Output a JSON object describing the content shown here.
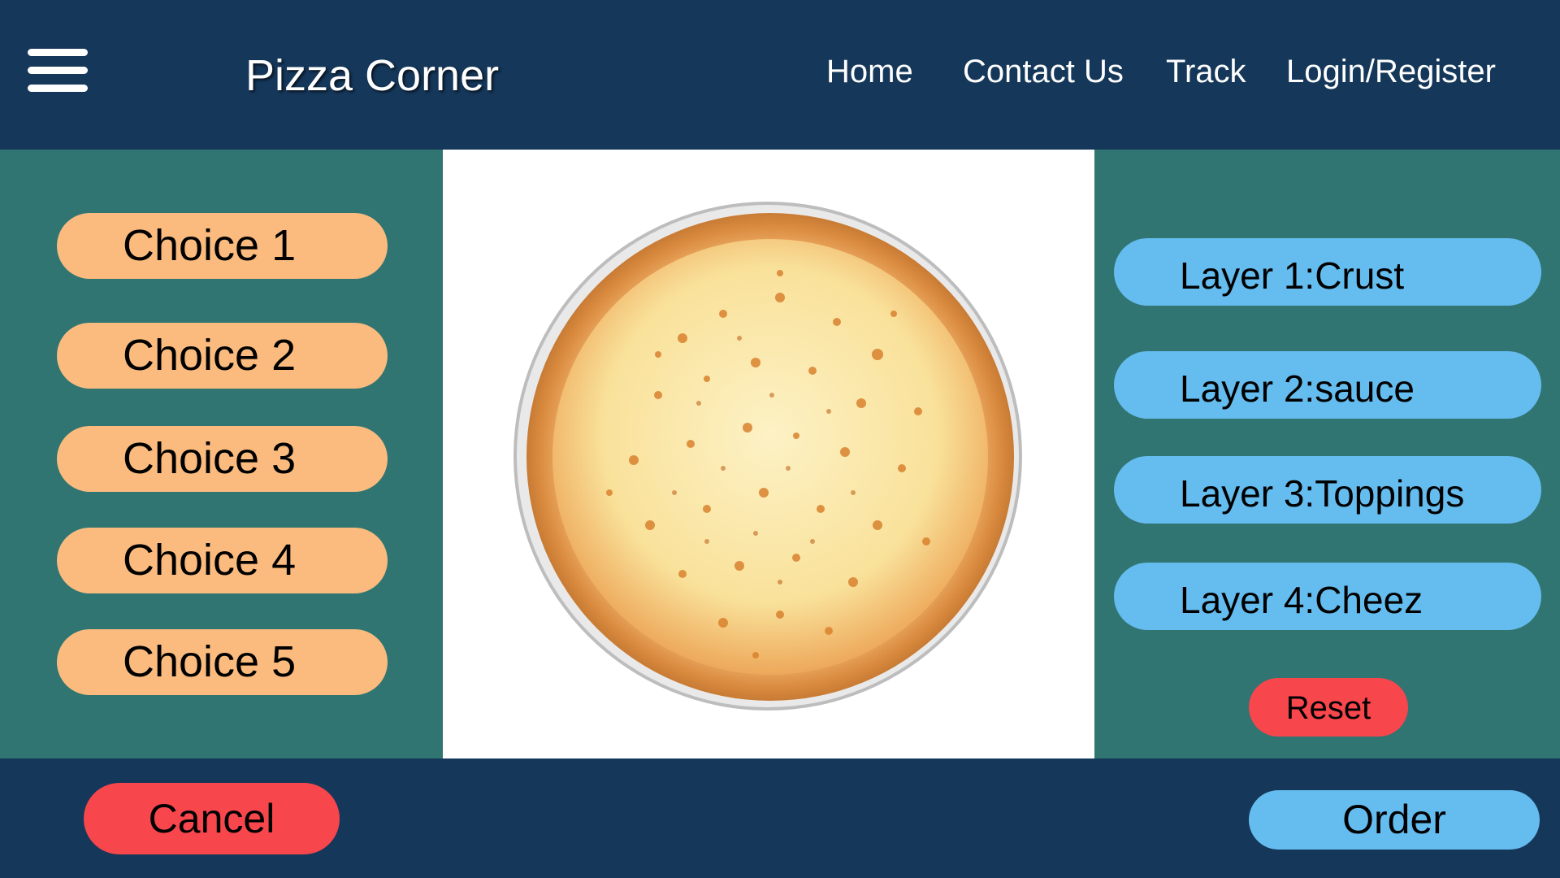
{
  "header": {
    "brand": "Pizza Corner",
    "menu_icon": "hamburger-menu-icon",
    "nav": {
      "home": "Home",
      "contact": "Contact Us",
      "track": "Track",
      "login": "Login/Register"
    }
  },
  "choices": [
    "Choice 1",
    "Choice 2",
    "Choice 3",
    "Choice 4",
    "Choice 5"
  ],
  "layers": [
    "Layer 1:Crust",
    "Layer 2:sauce",
    "Layer 3:Toppings",
    "Layer 4:Cheez"
  ],
  "reset_label": "Reset",
  "footer": {
    "cancel_label": "Cancel",
    "order_label": "Order"
  },
  "preview": {
    "image": "cheese-pizza-image"
  },
  "colors": {
    "header_bg": "#15375a",
    "panel_bg": "#307571",
    "choice_button": "#fbbb7e",
    "layer_button": "#65bcef",
    "danger_button": "#f7464c"
  }
}
